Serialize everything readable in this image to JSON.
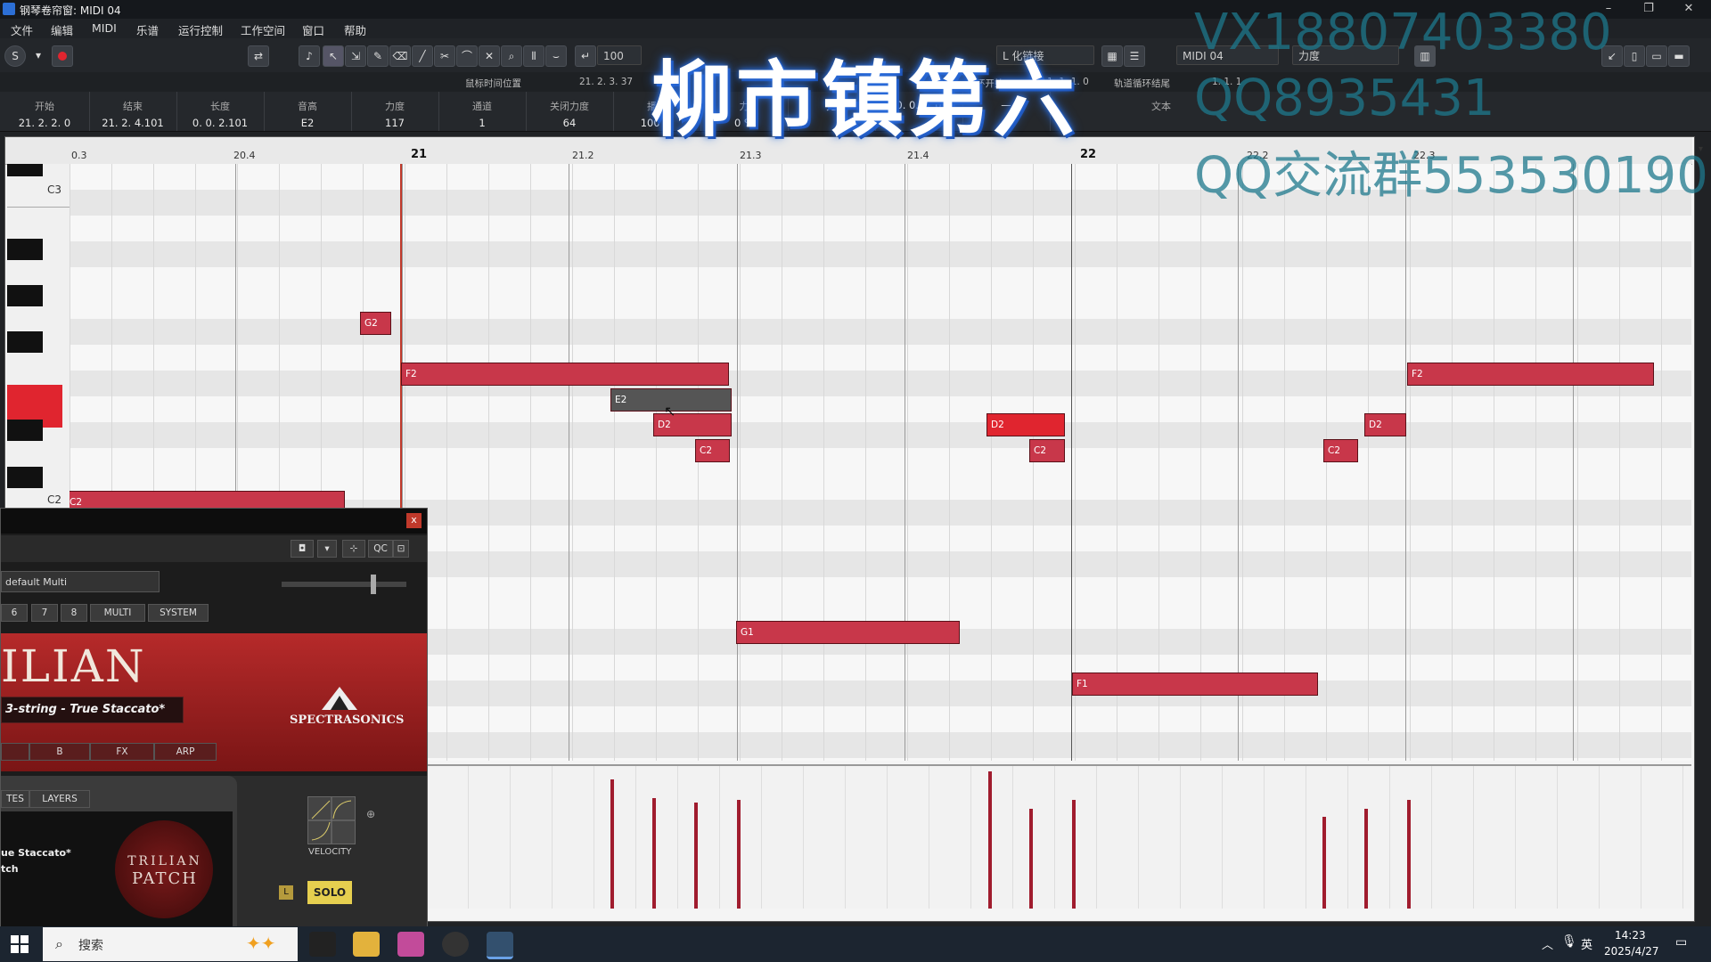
{
  "window": {
    "title": "钢琴卷帘窗: MIDI 04",
    "min": "–",
    "max": "❐",
    "close": "✕"
  },
  "menu": [
    "文件",
    "编辑",
    "MIDI",
    "乐谱",
    "运行控制",
    "工作空间",
    "窗口",
    "帮助"
  ],
  "toolbar": {
    "velocity_value": "100",
    "link_label": "L  化链接",
    "track_select": "MIDI 04",
    "vel_select": "力度",
    "mouse_pos_label": "鼠标时间位置",
    "mouse_pos_value": "21. 2. 3. 37",
    "cycle_label": "环开始",
    "cycle_value": "1. 1. 1.  0",
    "track_cycle_label": "轨道循环结尾",
    "track_cycle_value": "1. 1. 1"
  },
  "infoline": [
    {
      "label": "开始",
      "value": "21. 2. 2.   0"
    },
    {
      "label": "结束",
      "value": "21. 2. 4.101"
    },
    {
      "label": "长度",
      "value": "0. 0. 2.101"
    },
    {
      "label": "音高",
      "value": "E2"
    },
    {
      "label": "力度",
      "value": "117"
    },
    {
      "label": "通道",
      "value": "1"
    },
    {
      "label": "关闭力度",
      "value": "64"
    },
    {
      "label": "播放",
      "value": "100 %"
    },
    {
      "label": "力",
      "value": "0 %"
    },
    {
      "label": "",
      "value": "无"
    },
    {
      "label": "",
      "value": "0. 0. 0.   0"
    },
    {
      "label": "",
      "value": "—"
    },
    {
      "label": "文本",
      "value": ""
    }
  ],
  "ruler": [
    "0.3",
    "20.4",
    "21",
    "21.2",
    "21.3",
    "21.4",
    "22",
    "22.2",
    "22.3"
  ],
  "keys": {
    "c3": "C3",
    "c2": "C2"
  },
  "notes": [
    {
      "label": "G2",
      "selected": false
    },
    {
      "label": "F2",
      "selected": false
    },
    {
      "label": "E2",
      "selected": true
    },
    {
      "label": "D2",
      "selected": false
    },
    {
      "label": "C2",
      "selected": false
    },
    {
      "label": "D2",
      "selected": false
    },
    {
      "label": "C2",
      "selected": false
    },
    {
      "label": "C2",
      "selected": false
    },
    {
      "label": "G1",
      "selected": false
    },
    {
      "label": "F1",
      "selected": false
    },
    {
      "label": "C2",
      "selected": false
    },
    {
      "label": "D2",
      "selected": false
    },
    {
      "label": "F2",
      "selected": false
    },
    {
      "label": "C2",
      "selected": false
    }
  ],
  "plugin": {
    "close": "x",
    "multi_select": "default Multi",
    "tabs": [
      "6",
      "7",
      "8",
      "MULTI",
      "SYSTEM"
    ],
    "brand": "ILIAN",
    "patch": "3-string - True Staccato*",
    "company": "SPECTRASONICS",
    "sub_tabs": [
      "",
      "B",
      "FX",
      "ARP"
    ],
    "layer_tabs": [
      "TES",
      "LAYERS"
    ],
    "patch_line1": "ue Staccato*",
    "patch_line2": "tch",
    "logo_line1": "TRILIAN",
    "logo_line2": "PATCH",
    "velocity_label": "VELOCITY",
    "solo_label": "SOLO",
    "l_label": "L",
    "qc_label": "QC"
  },
  "overlay": {
    "title": "柳市镇第六",
    "wm1": "VX18807403380",
    "wm2": "QQ8935431",
    "wm3": "QQ交流群553530190"
  },
  "taskbar": {
    "search": "搜索",
    "lang": "英",
    "time": "14:23",
    "date": "2025/4/27"
  },
  "colors": {
    "note": "#c8374a",
    "note_selected": "#555555",
    "accent_red": "#e0252f",
    "playhead": "#c0392b"
  }
}
